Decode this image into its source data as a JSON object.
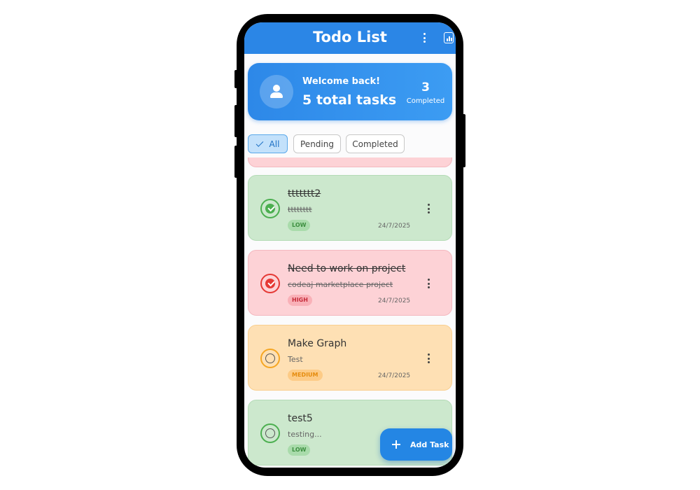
{
  "app": {
    "title": "Todo List"
  },
  "welcome": {
    "greeting": "Welcome back!",
    "total": "5 total tasks",
    "completed_count": "3",
    "completed_label": "Completed"
  },
  "filters": [
    {
      "label": "All",
      "selected": true
    },
    {
      "label": "Pending",
      "selected": false
    },
    {
      "label": "Completed",
      "selected": false
    }
  ],
  "tasks": [
    {
      "title": "ttttttt2",
      "description": "tttttttt",
      "priority": "LOW",
      "date": "24/7/2025",
      "completed": true,
      "color": "#4caf50"
    },
    {
      "title": "Need to work on project",
      "description": "codeaj marketplace project",
      "priority": "HIGH",
      "date": "24/7/2025",
      "completed": true,
      "color": "#e53935"
    },
    {
      "title": "Make Graph",
      "description": "Test",
      "priority": "MEDIUM",
      "date": "24/7/2025",
      "completed": false,
      "color": "#f5a623"
    },
    {
      "title": "test5",
      "description": "testing...",
      "priority": "LOW",
      "date": "",
      "completed": false,
      "color": "#4caf50"
    }
  ],
  "fab": {
    "label": "Add Task"
  },
  "colors": {
    "primary": "#2b86e6",
    "low": "#4caf50",
    "high": "#e53935",
    "medium": "#f5a623"
  }
}
